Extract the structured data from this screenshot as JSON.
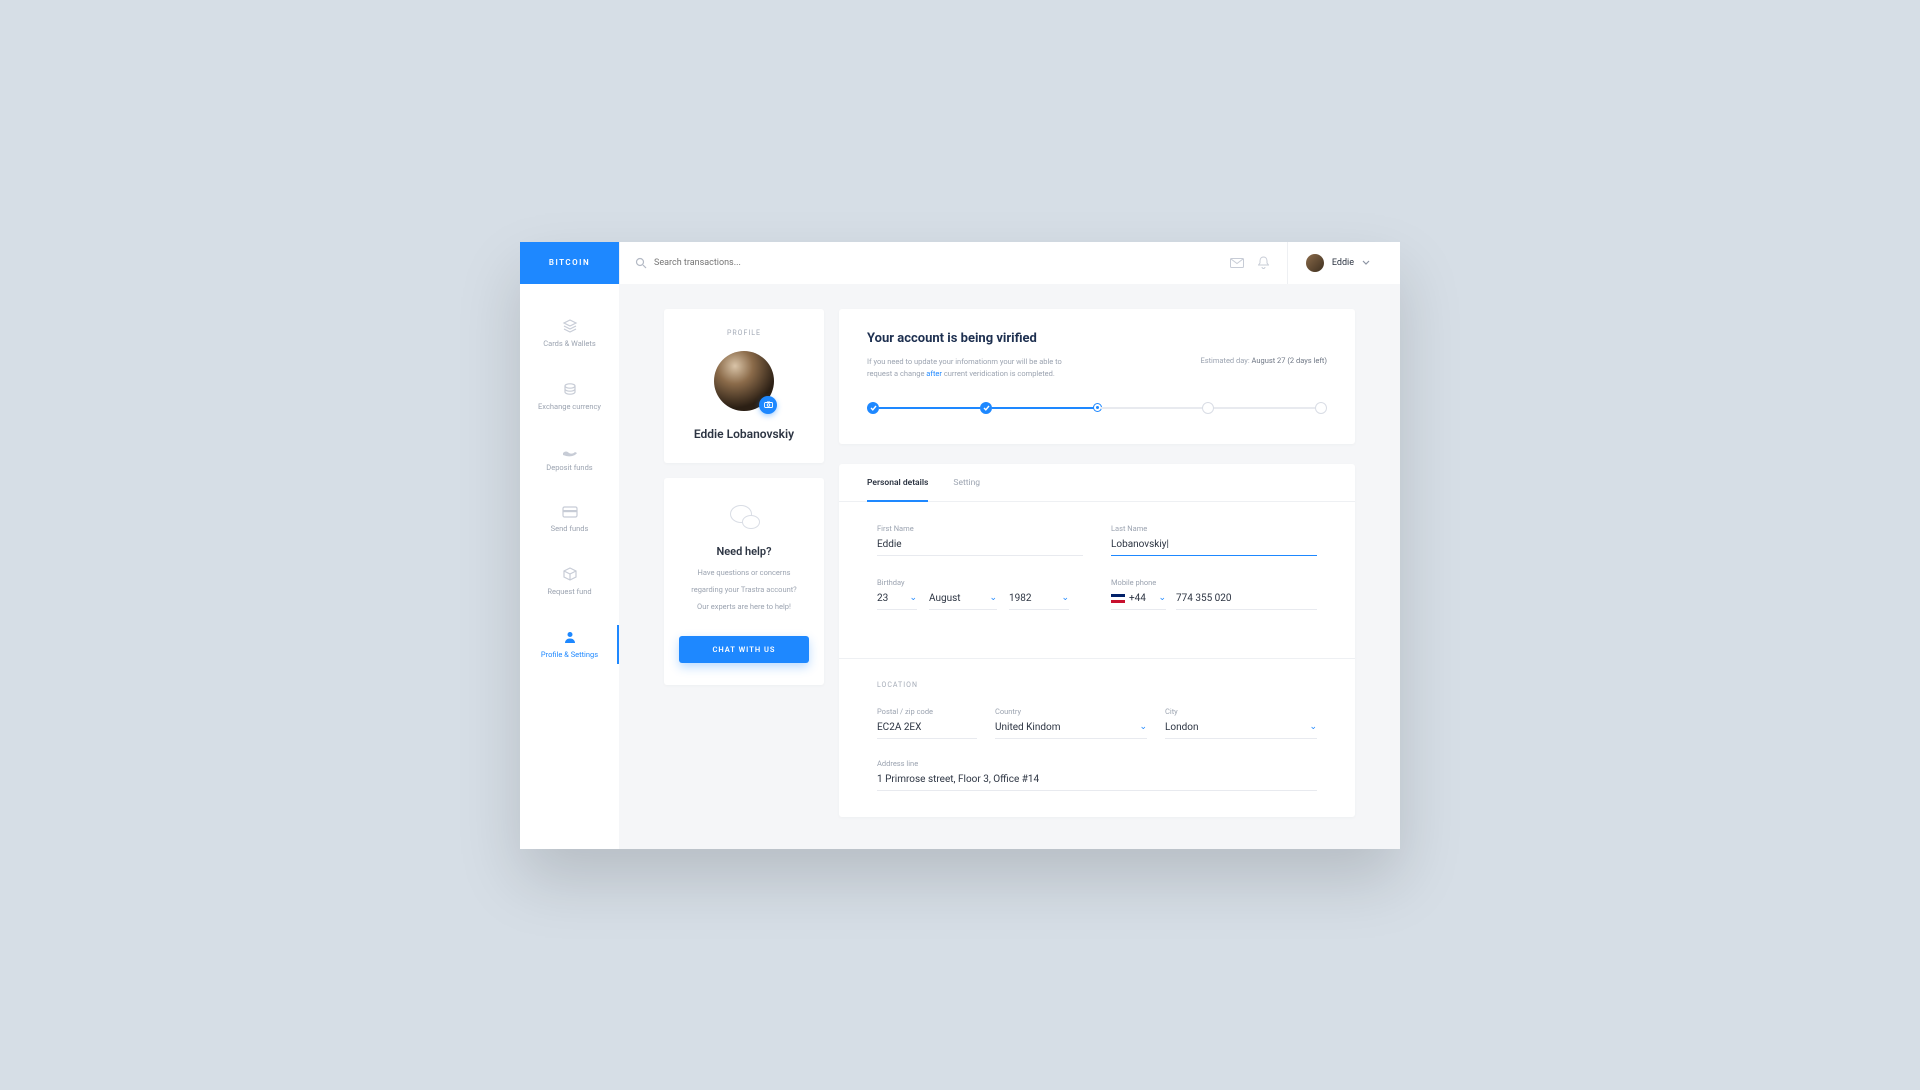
{
  "brand": "BITCOIN",
  "search": {
    "placeholder": "Search transactions..."
  },
  "user": {
    "name": "Eddie"
  },
  "sidebar": {
    "items": [
      {
        "label": "Cards & Wallets"
      },
      {
        "label": "Exchange currency"
      },
      {
        "label": "Deposit funds"
      },
      {
        "label": "Send funds"
      },
      {
        "label": "Request fund"
      },
      {
        "label": "Profile & Settings"
      }
    ]
  },
  "profile": {
    "section_label": "PROFILE",
    "name": "Eddie Lobanovskiy"
  },
  "help": {
    "title": "Need help?",
    "line1": "Have questions or concerns",
    "line2": "regarding your Trastra account?",
    "line3": "Our experts are here to help!",
    "button": "CHAT WITH US"
  },
  "verify": {
    "title": "Your account is being virified",
    "text_pre": "If you need to update your infomationm your will be able to request a change ",
    "text_link": "after",
    "text_post": " current veridication is completed.",
    "est_label": "Estimated day:",
    "est_value": "August 27 (2 days left)"
  },
  "tabs": {
    "personal": "Personal details",
    "setting": "Setting"
  },
  "form": {
    "first_name_label": "First Name",
    "first_name": "Eddie",
    "last_name_label": "Last Name",
    "last_name": "Lobanovskiy|",
    "birthday_label": "Birthday",
    "day": "23",
    "month": "August",
    "year": "1982",
    "mobile_label": "Mobile phone",
    "country_code": "+44",
    "phone": "774 355 020",
    "location_title": "LOCATION",
    "postal_label": "Postal / zip code",
    "postal": "EC2A 2EX",
    "country_label": "Country",
    "country": "United Kindom",
    "city_label": "City",
    "city": "London",
    "address_label": "Address line",
    "address": "1 Primrose street, Floor 3, Office #14"
  }
}
